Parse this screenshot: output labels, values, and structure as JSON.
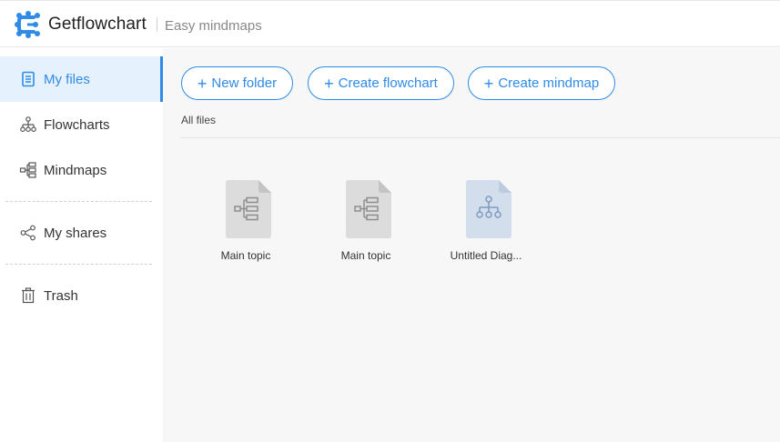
{
  "header": {
    "brand": "Getflowchart",
    "tagline": "Easy mindmaps"
  },
  "sidebar": {
    "items": [
      {
        "label": "My files",
        "icon": "file-list-icon",
        "active": true
      },
      {
        "label": "Flowcharts",
        "icon": "org-chart-icon",
        "active": false
      },
      {
        "label": "Mindmaps",
        "icon": "mindmap-icon",
        "active": false
      },
      {
        "label": "My shares",
        "icon": "share-icon",
        "active": false
      },
      {
        "label": "Trash",
        "icon": "trash-icon",
        "active": false
      }
    ]
  },
  "toolbar": {
    "new_folder": "New folder",
    "create_flowchart": "Create flowchart",
    "create_mindmap": "Create mindmap"
  },
  "breadcrumb": "All files",
  "files": [
    {
      "name": "Main topic",
      "type": "mindmap",
      "icon": "mindmap-file-icon"
    },
    {
      "name": "Main topic",
      "type": "mindmap",
      "icon": "mindmap-file-icon"
    },
    {
      "name": "Untitled Diag...",
      "type": "flowchart",
      "icon": "flowchart-file-icon"
    }
  ],
  "colors": {
    "accent": "#2f8be6",
    "active_bg": "#e5f1fc",
    "main_bg": "#f7f7f7",
    "mindmap_doc": "#dcdcdc",
    "flowchart_doc": "#d3deec"
  }
}
